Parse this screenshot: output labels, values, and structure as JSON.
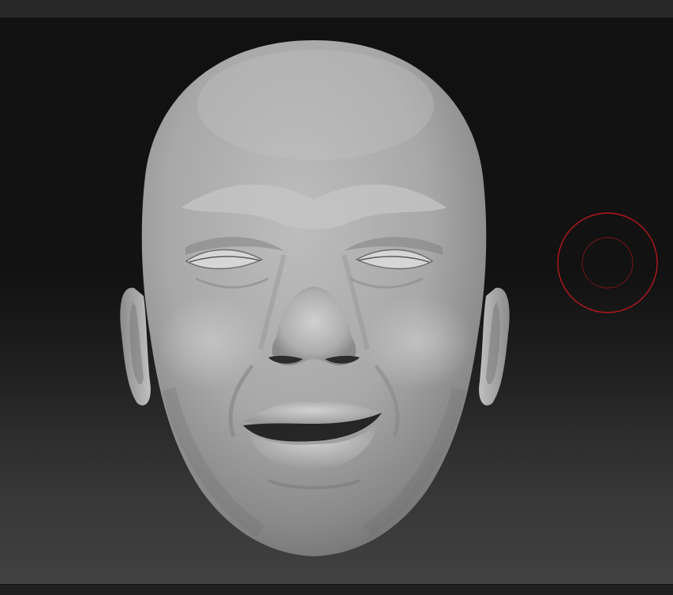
{
  "app": {
    "viewport_subject": "sculpted-head",
    "brush": {
      "outer_color": "#b5161c",
      "inner_color": "#6a1418"
    },
    "colors": {
      "background_top": "#111111",
      "background_bottom": "#414141",
      "mesh_base": "#9a9a9a",
      "toolbar": "#282828"
    }
  }
}
